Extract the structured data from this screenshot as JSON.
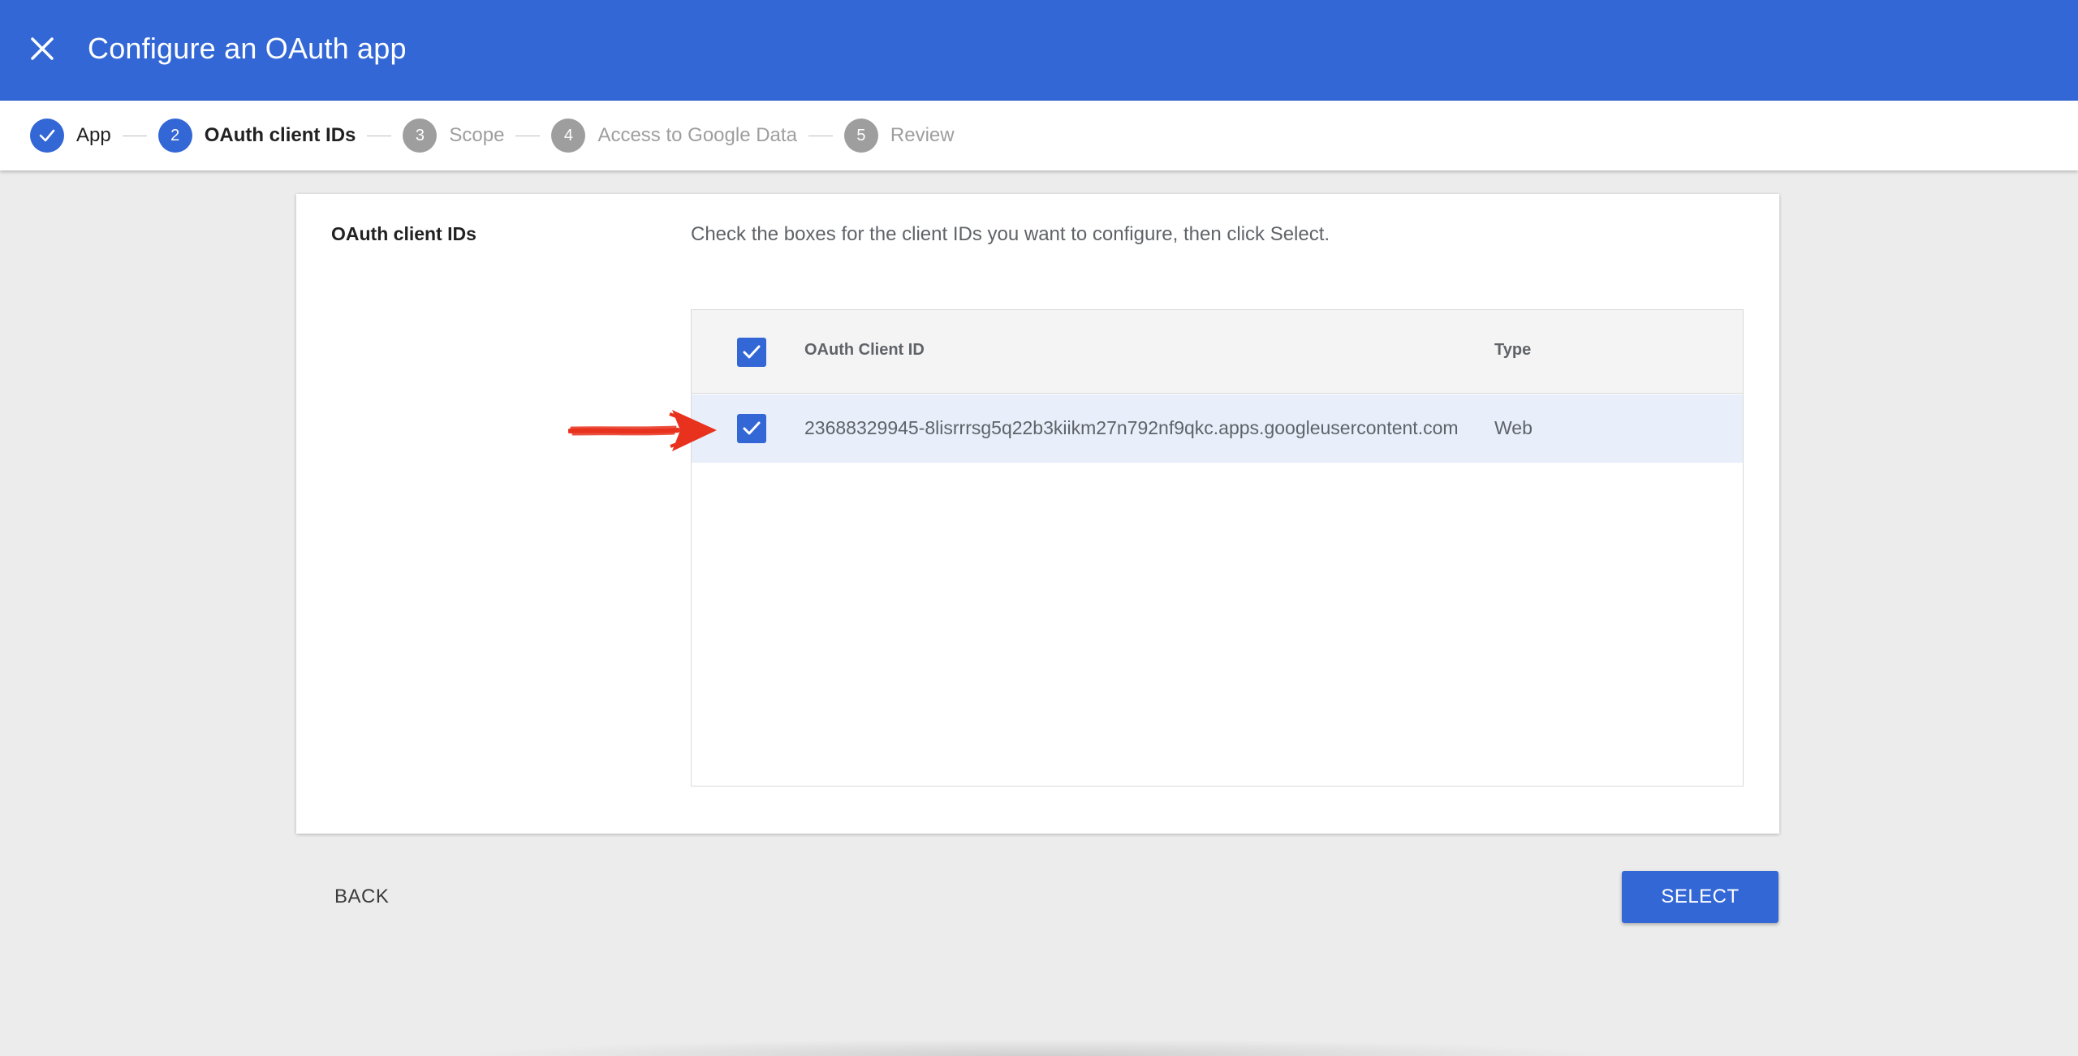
{
  "header": {
    "title": "Configure an OAuth app",
    "close_icon": "close-icon",
    "background_color": "#3367d6"
  },
  "stepper": {
    "steps": [
      {
        "number": "1",
        "label": "App",
        "state": "done"
      },
      {
        "number": "2",
        "label": "OAuth client IDs",
        "state": "active"
      },
      {
        "number": "3",
        "label": "Scope",
        "state": "pending"
      },
      {
        "number": "4",
        "label": "Access to Google Data",
        "state": "pending"
      },
      {
        "number": "5",
        "label": "Review",
        "state": "pending"
      }
    ]
  },
  "card": {
    "section_title": "OAuth client IDs",
    "description": "Check the boxes for the client IDs you want to configure, then click Select.",
    "table": {
      "headers": {
        "client_id": "OAuth Client ID",
        "type": "Type"
      },
      "select_all_checked": true,
      "rows": [
        {
          "checked": true,
          "client_id": "23688329945-8lisrrrsg5q22b3kiikm27n792nf9qkc.apps.googleusercontent.com",
          "type": "Web"
        }
      ]
    }
  },
  "annotation": {
    "icon": "red-arrow-annotation",
    "color": "#e8321e"
  },
  "footer": {
    "back_label": "BACK",
    "select_label": "SELECT"
  }
}
